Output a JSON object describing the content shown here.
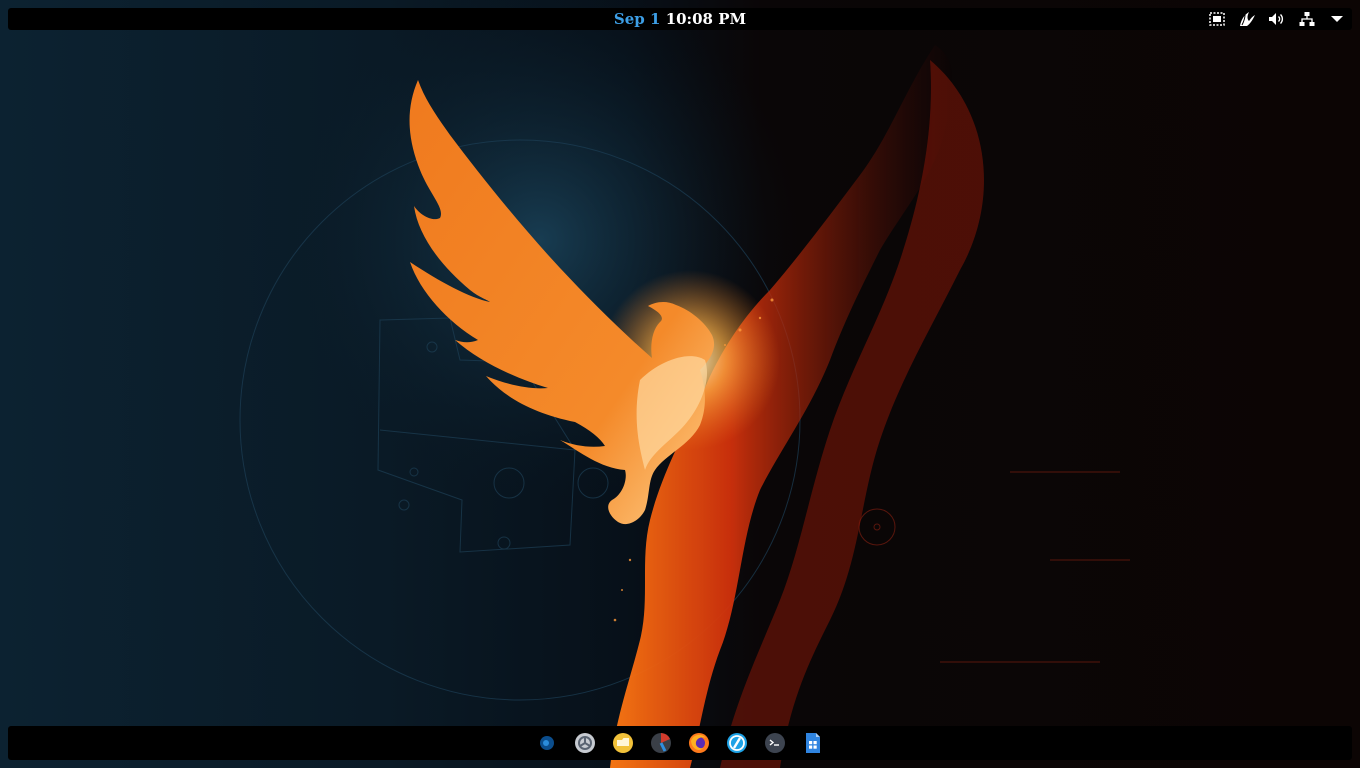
{
  "top_bar": {
    "date": "Sep 1",
    "time": "10:08 PM",
    "tray_icons": [
      "screenshot-icon",
      "parrot-icon",
      "volume-icon",
      "network-icon",
      "menu-arrow-icon"
    ]
  },
  "dock": {
    "items": [
      "parrot-menu",
      "settings",
      "files",
      "system-monitor",
      "firefox",
      "browser",
      "terminal",
      "document-viewer"
    ]
  },
  "colors": {
    "bar_background": "#000000",
    "date_accent": "#3d9ee5",
    "phoenix_orange": "#f07a1e",
    "fire_red": "#c42a0b"
  }
}
